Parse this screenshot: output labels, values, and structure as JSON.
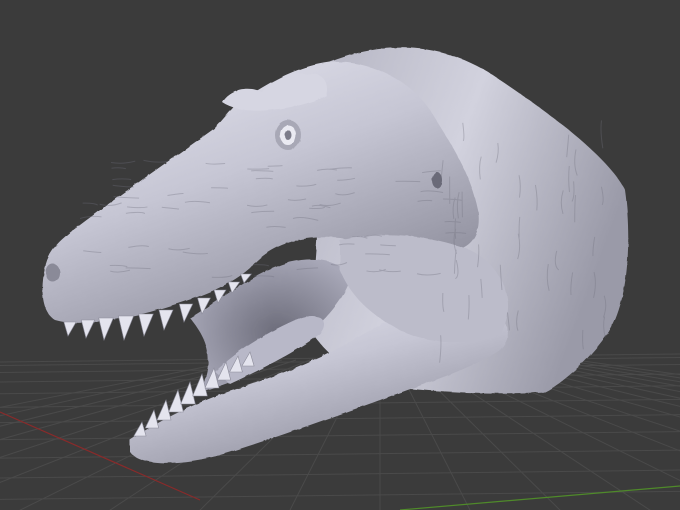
{
  "viewport": {
    "background_color": "#3b3b3b",
    "grid_line_color": "#4a4a4a",
    "x_axis_color": "#8a2a2a",
    "y_axis_color": "#4f8a2a",
    "model_color": "#c9c9d6",
    "model_shadow_color": "#7a7a88",
    "model_highlight_color": "#ececf4"
  },
  "model": {
    "subject": "tyrannosaurus-head-sculpt",
    "shading": "solid-clay"
  }
}
